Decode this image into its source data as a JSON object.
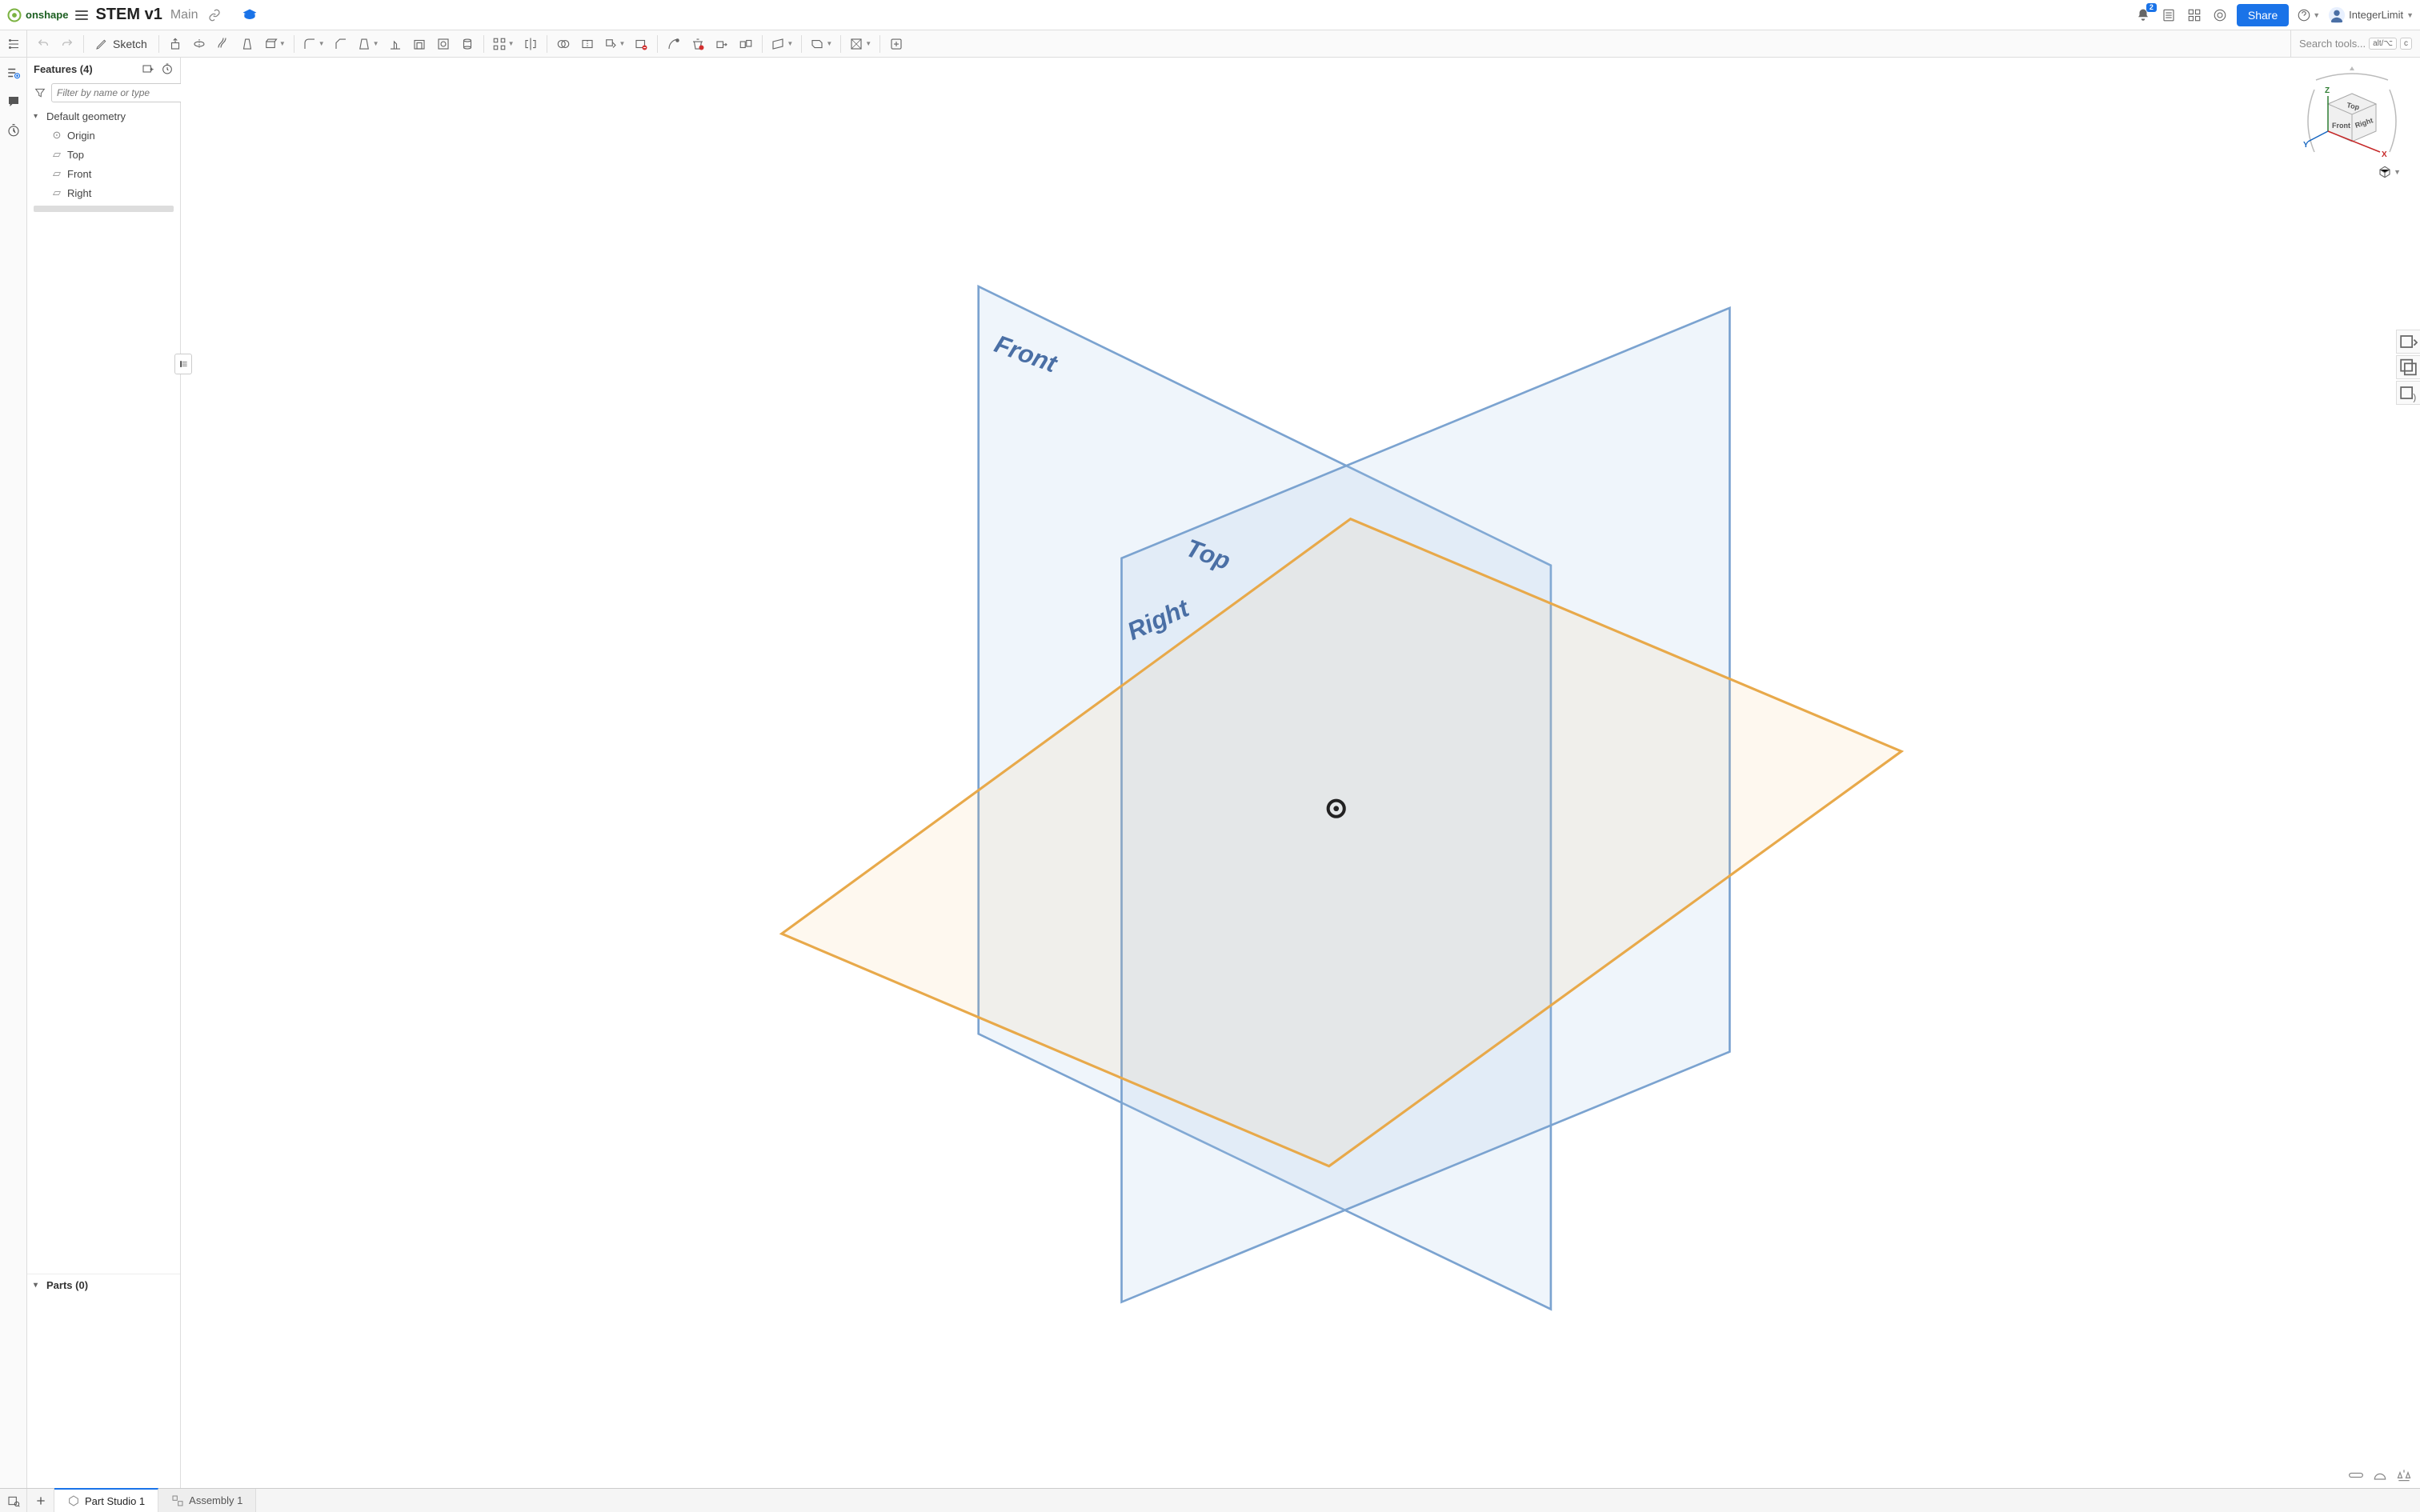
{
  "header": {
    "brand": "onshape",
    "doc_title": "STEM v1",
    "branch": "Main",
    "share_label": "Share",
    "user_name": "IntegerLimit",
    "notification_count": "2"
  },
  "toolbar": {
    "sketch_label": "Sketch",
    "search_placeholder": "Search tools...",
    "kbd1": "alt/⌥",
    "kbd2": "c"
  },
  "feature_panel": {
    "title": "Features (4)",
    "filter_placeholder": "Filter by name or type",
    "default_geometry": "Default geometry",
    "items": [
      {
        "label": "Origin",
        "icon": "origin"
      },
      {
        "label": "Top",
        "icon": "plane"
      },
      {
        "label": "Front",
        "icon": "plane"
      },
      {
        "label": "Right",
        "icon": "plane"
      }
    ],
    "parts_title": "Parts (0)"
  },
  "canvas": {
    "plane_front": "Front",
    "plane_top": "Top",
    "plane_right": "Right"
  },
  "viewcube": {
    "top": "Top",
    "front": "Front",
    "right": "Right",
    "axis_x": "X",
    "axis_y": "Y",
    "axis_z": "Z"
  },
  "tabs": {
    "part_studio": "Part Studio 1",
    "assembly": "Assembly 1"
  }
}
